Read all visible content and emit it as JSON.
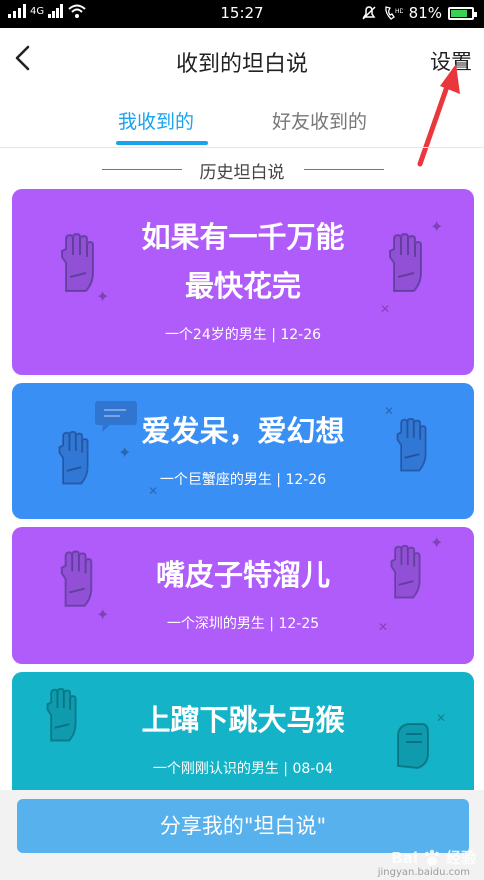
{
  "status_bar": {
    "signal": "4G",
    "time": "15:27",
    "battery_percent": 81,
    "battery_label": "81%"
  },
  "nav": {
    "title": "收到的坦白说",
    "settings_label": "设置"
  },
  "tabs": [
    {
      "label": "我收到的",
      "active": true
    },
    {
      "label": "好友收到的",
      "active": false
    }
  ],
  "section": {
    "title": "历史坦白说"
  },
  "cards": [
    {
      "text_line1": "如果有一千万能",
      "text_line2": "最快花完",
      "meta": "一个24岁的男生 | 12-26",
      "color": "#b05cfa"
    },
    {
      "text_line1": "爱发呆，爱幻想",
      "text_line2": "",
      "meta": "一个巨蟹座的男生 | 12-26",
      "color": "#3a8ff5"
    },
    {
      "text_line1": "嘴皮子特溜儿",
      "text_line2": "",
      "meta": "一个深圳的男生 | 12-25",
      "color": "#b05cfa"
    },
    {
      "text_line1": "上蹿下跳大马猴",
      "text_line2": "",
      "meta": "一个刚刚认识的男生 | 08-04",
      "color": "#14b3c7"
    }
  ],
  "share": {
    "label": "分享我的\"坦白说\""
  },
  "watermark": {
    "brand": "Bai",
    "brand_suffix": "经验",
    "url": "jingyan.baidu.com"
  },
  "colors": {
    "accent": "#1aa3ec",
    "annotation_arrow": "#e8383d"
  }
}
